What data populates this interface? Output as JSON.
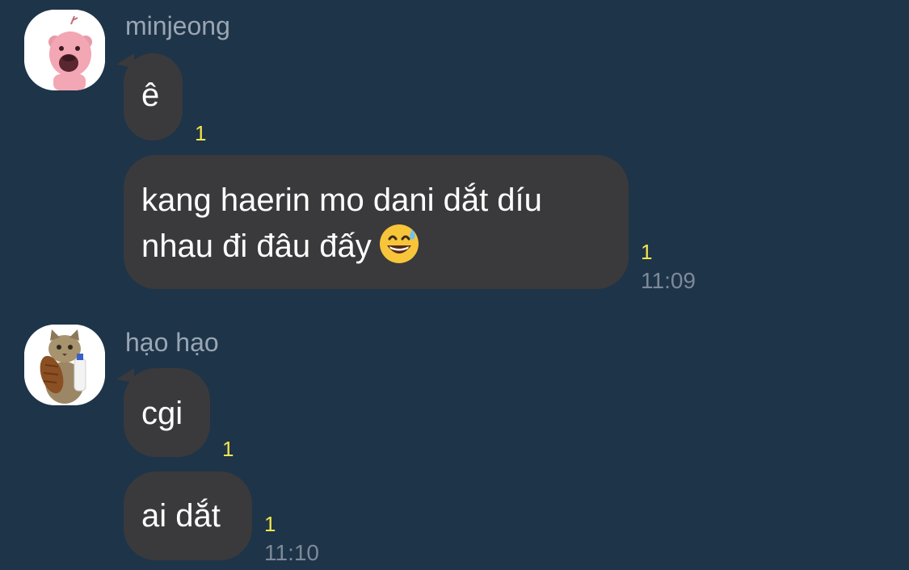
{
  "colors": {
    "background": "#1e3449",
    "bubble": "#3a3a3c",
    "unread": "#f2e54b",
    "sender": "#9aa6b3",
    "time": "#7d8a97"
  },
  "groups": [
    {
      "sender": "minjeong",
      "avatar_icon": "pink-beaver-avatar-icon",
      "messages": [
        {
          "lines": [
            "ê"
          ],
          "unread": "1"
        },
        {
          "lines": [
            "kang haerin mo dani dắt díu",
            "nhau đi đâu đấy"
          ],
          "emoji": "grinning-sweat-emoji-icon",
          "unread": "1",
          "time": "11:09"
        }
      ]
    },
    {
      "sender": "hạo hạo",
      "avatar_icon": "cat-holding-bread-and-milk-avatar-icon",
      "messages": [
        {
          "lines": [
            "cgi"
          ],
          "unread": "1"
        },
        {
          "lines": [
            "ai dắt"
          ],
          "unread": "1",
          "time": "11:10"
        }
      ]
    }
  ]
}
